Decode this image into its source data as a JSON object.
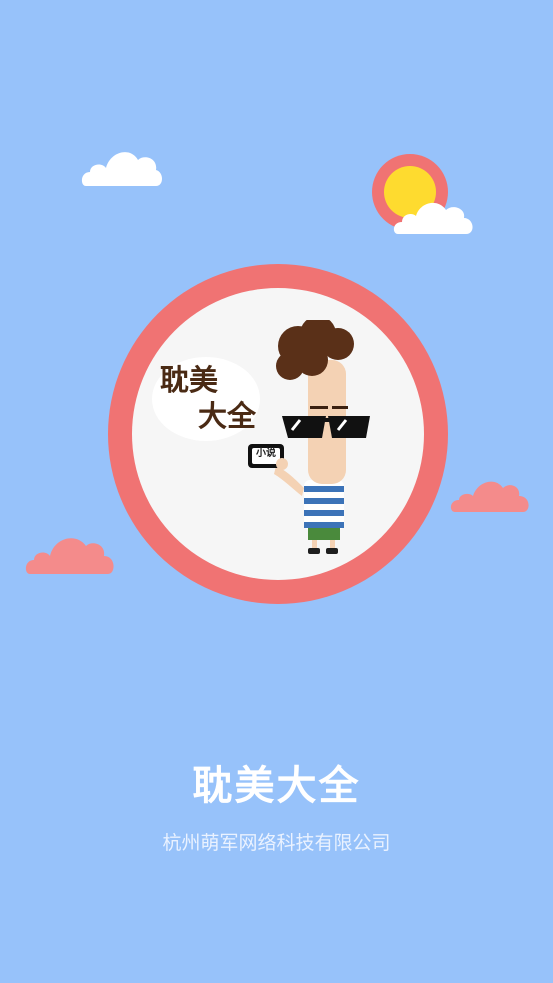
{
  "splash": {
    "logo_title_line1": "耽美",
    "logo_title_line2": "大全",
    "phone_label": "小说",
    "app_name": "耽美大全",
    "company": "杭州萌军网络科技有限公司"
  },
  "colors": {
    "background": "#97c2fa",
    "ring": "#f07373",
    "sun": "#fedb2f",
    "pink_cloud": "#f48b8b",
    "white_cloud": "#ffffff",
    "logo_text": "#4a2a14"
  },
  "icons": {
    "white_cloud": "cloud-icon",
    "sun": "sun-icon",
    "pink_cloud": "cloud-icon",
    "mascot": "mascot-illustration"
  }
}
